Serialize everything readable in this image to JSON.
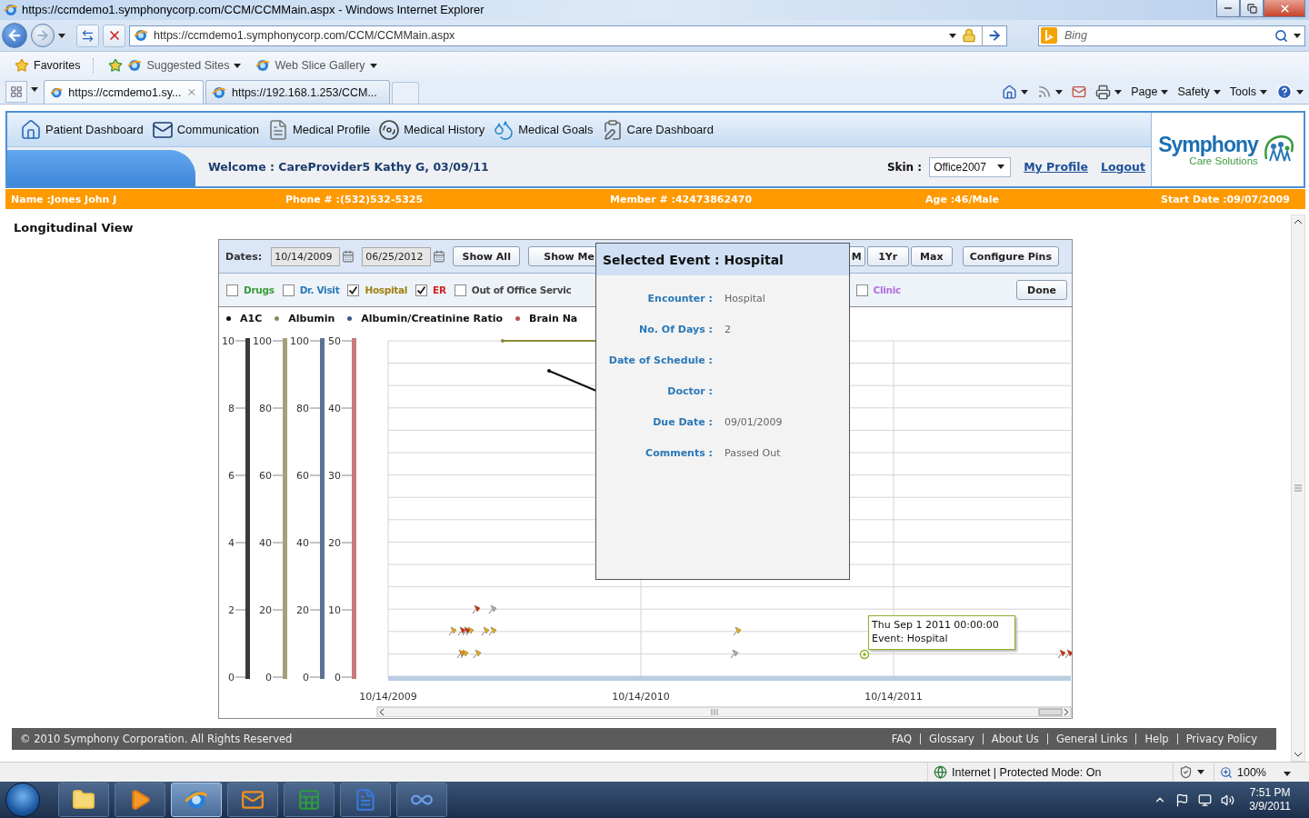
{
  "window": {
    "title": "https://ccmdemo1.symphonycorp.com/CCM/CCMMain.aspx - Windows Internet Explorer"
  },
  "address_bar": {
    "url": "https://ccmdemo1.symphonycorp.com/CCM/CCMMain.aspx"
  },
  "search": {
    "placeholder": "Bing"
  },
  "favorites_bar": [
    {
      "label": "Favorites",
      "kind": "favorites"
    },
    {
      "label": "Suggested Sites",
      "kind": "menu"
    },
    {
      "label": "Web Slice Gallery",
      "kind": "menu"
    }
  ],
  "browser_tabs": [
    {
      "label": "https://ccmdemo1.sy...",
      "selected": true
    },
    {
      "label": "https://192.168.1.253/CCM...",
      "selected": false
    }
  ],
  "command_bar": [
    "Page",
    "Safety",
    "Tools"
  ],
  "nav": [
    {
      "label": "Patient Dashboard",
      "kind": "home"
    },
    {
      "label": "Communication",
      "kind": "mail"
    },
    {
      "label": "Medical Profile",
      "kind": "profile"
    },
    {
      "label": "Medical History",
      "kind": "history"
    },
    {
      "label": "Medical Goals",
      "kind": "goals"
    },
    {
      "label": "Care Dashboard",
      "kind": "care"
    }
  ],
  "logo": {
    "name": "Symphony",
    "tagline": "Care Solutions"
  },
  "welcome": "Welcome : CareProvider5 Kathy G, 03/09/11",
  "skin": {
    "label": "Skin :",
    "value": "Office2007"
  },
  "profile_links": [
    "My Profile",
    "Logout"
  ],
  "patient": [
    "Name :Jones John J",
    "Phone # :(532)532-5325",
    "Member # :42473862470",
    "Age :46/Male",
    "Start Date :09/07/2009"
  ],
  "page_title": "Longitudinal View",
  "chart_panel": {
    "dates_label": "Dates:",
    "from": "10/14/2009",
    "to": "06/25/2012",
    "left_buttons": [
      "Show All",
      "Show Me"
    ],
    "range_buttons": [
      "M",
      "1Yr",
      "Max"
    ],
    "config_button": "Configure Pins",
    "filters": [
      {
        "label": "Drugs",
        "checked": false,
        "color": "#3a9a3a"
      },
      {
        "label": "Dr. Visit",
        "checked": false,
        "color": "#2a7ab8"
      },
      {
        "label": "Hospital",
        "checked": true,
        "color": "#a08010"
      },
      {
        "label": "ER",
        "checked": true,
        "color": "#d42020"
      },
      {
        "label": "Out of Office Servic",
        "checked": false,
        "color": "#444444"
      },
      {
        "label": "Clinic",
        "checked": false,
        "color": "#b070d8"
      }
    ],
    "done_button": "Done",
    "legend": [
      {
        "label": "A1C",
        "color": "#111111"
      },
      {
        "label": "Albumin",
        "color": "#8b8b5a"
      },
      {
        "label": "Albumin/Creatinine Ratio",
        "color": "#3a5a8a"
      },
      {
        "label": "Brain Na",
        "color": "#c0504d"
      }
    ],
    "axes": [
      {
        "color": "#3a3a3a",
        "ticks": [
          "10",
          "8",
          "6",
          "4",
          "2",
          "0"
        ]
      },
      {
        "color": "#a89f7a",
        "ticks": [
          "100",
          "80",
          "60",
          "40",
          "20",
          "0"
        ]
      },
      {
        "color": "#5b7391",
        "ticks": [
          "100",
          "80",
          "60",
          "40",
          "20",
          "0"
        ]
      },
      {
        "color": "#c97a7a",
        "ticks": [
          "50",
          "40",
          "30",
          "20",
          "10",
          "0"
        ]
      }
    ],
    "x_labels": [
      "10/14/2009",
      "10/14/2010",
      "10/14/2011"
    ],
    "popup": {
      "title": "Selected Event : Hospital",
      "fields": [
        {
          "label": "Encounter :",
          "value": "Hospital"
        },
        {
          "label": "No. Of Days :",
          "value": "2"
        },
        {
          "label": "Date of Schedule :"
        },
        {
          "label": "Doctor :"
        },
        {
          "label": "Due Date :",
          "value": "09/01/2009"
        },
        {
          "label": "Comments :",
          "value": "Passed Out"
        }
      ]
    },
    "tooltip": [
      "Thu Sep 1 2011 00:00:00",
      "Event: Hospital"
    ]
  },
  "footer": {
    "copyright": "© 2010 Symphony Corporation. All Rights Reserved",
    "links": [
      "FAQ",
      "Glossary",
      "About Us",
      "General Links",
      "Help",
      "Privacy Policy"
    ]
  },
  "status_bar": {
    "zone": "Internet | Protected Mode: On",
    "zoom": "100%"
  },
  "taskbar": {
    "apps": [
      {
        "kind": "folder",
        "selected": false
      },
      {
        "kind": "media",
        "selected": false
      },
      {
        "kind": "browser",
        "selected": true
      },
      {
        "kind": "mail",
        "selected": false
      },
      {
        "kind": "spreadsheet",
        "selected": false
      },
      {
        "kind": "document",
        "selected": false
      },
      {
        "kind": "loop",
        "selected": false
      }
    ],
    "time": "7:51 PM",
    "date": "3/9/2011"
  }
}
